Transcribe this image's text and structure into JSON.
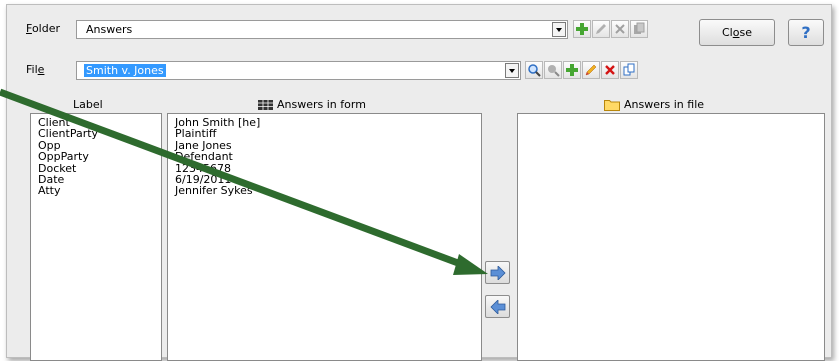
{
  "folder": {
    "label": "Folder",
    "mnemonic": "F",
    "label_rest": "older",
    "value": "Answers"
  },
  "file": {
    "label_start": "Fil",
    "mnemonic": "e",
    "value": "Smith v. Jones"
  },
  "close_button": {
    "label_start": "Cl",
    "mnemonic": "o",
    "label_end": "se"
  },
  "help_button": {
    "label": "?"
  },
  "columns": {
    "label_header": "Label",
    "form_header": "Answers in form",
    "file_header": "Answers in file"
  },
  "labels": [
    "Client",
    "ClientParty",
    "Opp",
    "OppParty",
    "Docket",
    "Date",
    "Atty"
  ],
  "answers": [
    "John Smith [he]",
    "Plaintiff",
    "Jane Jones",
    "Defendant",
    "12345678",
    "6/19/2011",
    "Jennifer Sykes"
  ],
  "colors": {
    "annotation_arrow": "#2e6b2e",
    "selection": "#3399ff",
    "add_green": "#46a632",
    "delete_red": "#d41414",
    "help_blue": "#2f6fc4"
  },
  "icons": {
    "folder_toolbar": [
      "add-icon",
      "edit-icon",
      "delete-icon",
      "copy-icon"
    ],
    "file_toolbar": [
      "search-icon",
      "search-next-icon",
      "add-icon",
      "edit-icon",
      "delete-icon",
      "copy-icon"
    ],
    "transfer": [
      "arrow-right-icon",
      "arrow-left-icon"
    ]
  }
}
